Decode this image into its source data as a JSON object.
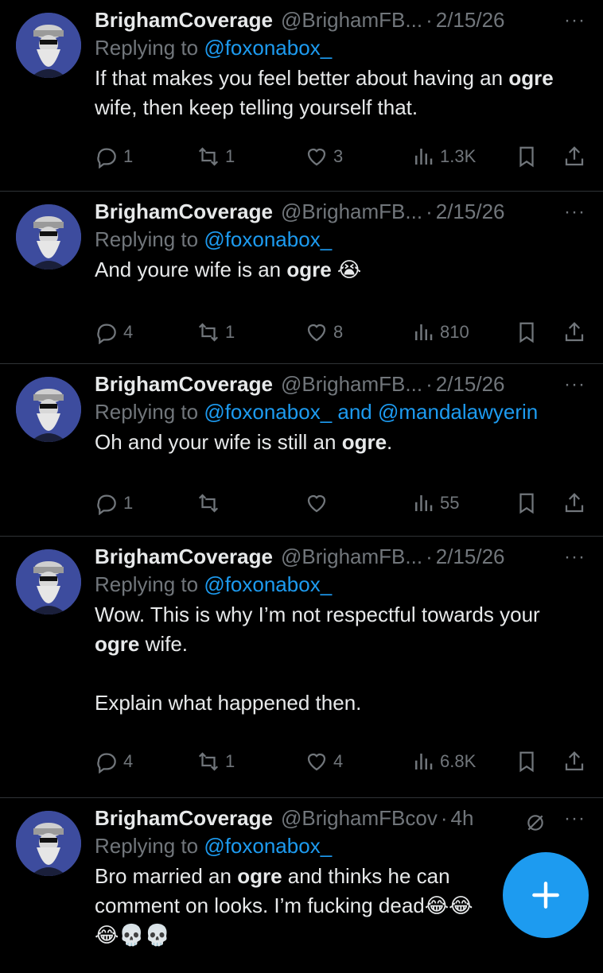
{
  "colors": {
    "background": "#000000",
    "text": "#e7e9ea",
    "muted": "#71767b",
    "accent": "#1d9bf0",
    "divider": "#2f3336"
  },
  "tweets": [
    {
      "name": "BrighamCoverage",
      "handle": "@BrighamFB...",
      "dot": "·",
      "time": "2/15/26",
      "replying_prefix": "Replying to ",
      "mentions": "@foxonabox_",
      "body_parts": [
        "If that makes you feel better about having an ",
        "ogre",
        " wife, then keep telling yourself that."
      ],
      "replies": "1",
      "retweets": "1",
      "likes": "3",
      "views": "1.3K"
    },
    {
      "name": "BrighamCoverage",
      "handle": "@BrighamFB...",
      "dot": "·",
      "time": "2/15/26",
      "replying_prefix": "Replying to ",
      "mentions": "@foxonabox_",
      "body_parts": [
        "And youre wife is an ",
        "ogre",
        " 😭"
      ],
      "replies": "4",
      "retweets": "1",
      "likes": "8",
      "views": "810"
    },
    {
      "name": "BrighamCoverage",
      "handle": "@BrighamFB...",
      "dot": "·",
      "time": "2/15/26",
      "replying_prefix": "Replying to ",
      "mentions": "@foxonabox_ and @mandalawyerin",
      "body_parts": [
        "Oh and your wife is still an ",
        "ogre",
        "."
      ],
      "replies": "1",
      "retweets": "",
      "likes": "",
      "views": "55"
    },
    {
      "name": "BrighamCoverage",
      "handle": "@BrighamFB...",
      "dot": "·",
      "time": "2/15/26",
      "replying_prefix": "Replying to ",
      "mentions": "@foxonabox_",
      "body_parts": [
        "Wow. This is why I’m not respectful towards your ",
        "ogre",
        " wife."
      ],
      "body_extra": "Explain what happened then.",
      "replies": "4",
      "retweets": "1",
      "likes": "4",
      "views": "6.8K"
    },
    {
      "name": "BrighamCoverage",
      "handle": "@BrighamFBcov",
      "dot": "·",
      "time": "4h",
      "replying_prefix": "Replying to ",
      "mentions": "@foxonabox_",
      "body_parts": [
        "Bro married an ",
        "ogre",
        " and thinks he can comment on looks. I’m fucking dead😂😂"
      ],
      "body_extra": "😂💀💀"
    }
  ],
  "more_label": "···",
  "fab_label": "+",
  "icons": [
    "reply-icon",
    "retweet-icon",
    "like-icon",
    "views-icon",
    "bookmark-icon",
    "share-icon",
    "grok-icon",
    "compose-plus-icon"
  ]
}
